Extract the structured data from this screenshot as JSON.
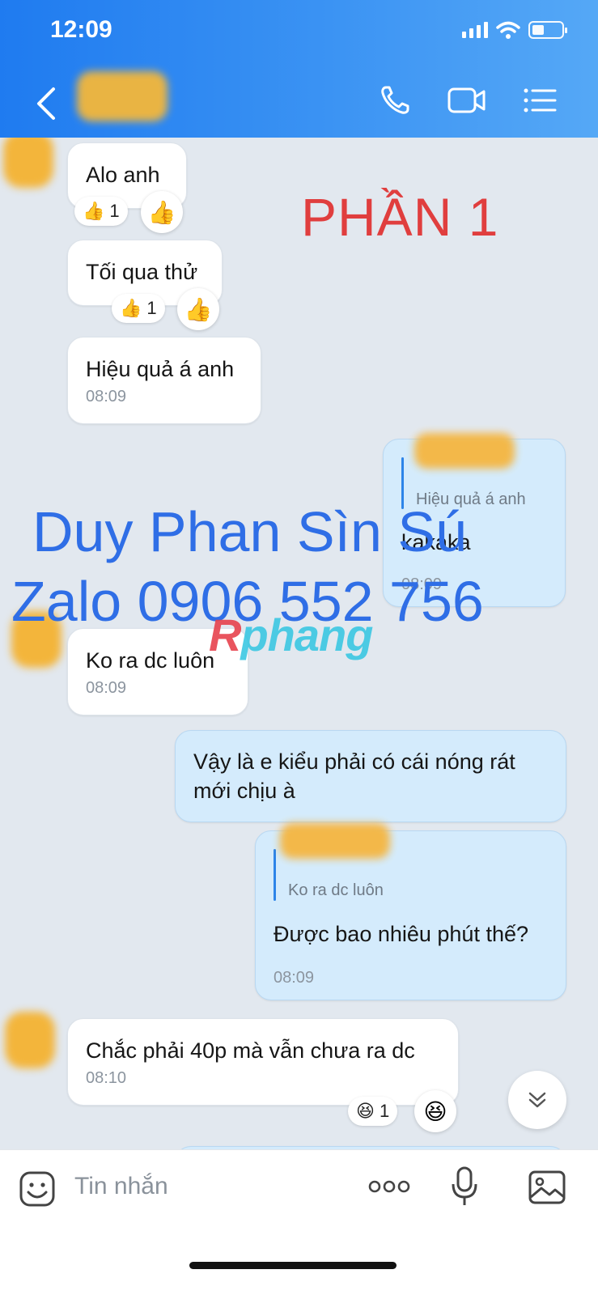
{
  "status_bar": {
    "time": "12:09"
  },
  "header": {
    "back_icon": "chevron-left-icon",
    "call_icon": "phone-icon",
    "video_icon": "video-icon",
    "menu_icon": "list-icon"
  },
  "watermark": {
    "part_label": "PHẦN 1",
    "name_line": "Duy Phan Sìn Sú",
    "zalo_line": "Zalo 0906 552 756",
    "brand_r": "R",
    "brand_rest": "phang"
  },
  "messages": [
    {
      "id": "m1",
      "direction": "incoming",
      "text": "Alo anh",
      "reaction": {
        "emoji": "👍",
        "count": "1"
      },
      "react_button": "👍"
    },
    {
      "id": "m2",
      "direction": "incoming",
      "text": "Tối qua thử",
      "reaction": {
        "emoji": "👍",
        "count": "1"
      },
      "react_button": "👍"
    },
    {
      "id": "m3",
      "direction": "incoming",
      "text": "Hiệu quả á anh",
      "time": "08:09"
    },
    {
      "id": "m4",
      "direction": "outgoing",
      "quote": "Hiệu quả á anh",
      "text": "kakaka",
      "time": "08:09"
    },
    {
      "id": "m5",
      "direction": "incoming",
      "text": "Ko ra dc luôn",
      "time": "08:09"
    },
    {
      "id": "m6",
      "direction": "outgoing",
      "lines": [
        "Vậy là e kiểu phải có cái nóng rát",
        "mới chịu à"
      ]
    },
    {
      "id": "m7",
      "direction": "outgoing",
      "quote": "Ko ra dc luôn",
      "text": "Được bao nhiêu phút thế?",
      "time": "08:09"
    },
    {
      "id": "m8",
      "direction": "incoming",
      "text": "Chắc phải 40p mà vẫn chưa ra dc",
      "time": "08:10",
      "reaction": {
        "emoji": "😆",
        "count": "1"
      },
      "react_button": "😆"
    }
  ],
  "input_bar": {
    "placeholder": "Tin nhắn",
    "sticker_icon": "sticker-icon",
    "more_icon": "more-dots-icon",
    "mic_icon": "microphone-icon",
    "image_icon": "image-icon"
  },
  "colors": {
    "header_start": "#1f7bf0",
    "header_end": "#55a8f6",
    "outgoing_bubble": "#d4ebfc",
    "incoming_bubble": "#ffffff",
    "chat_bg": "#e2e8ef"
  }
}
